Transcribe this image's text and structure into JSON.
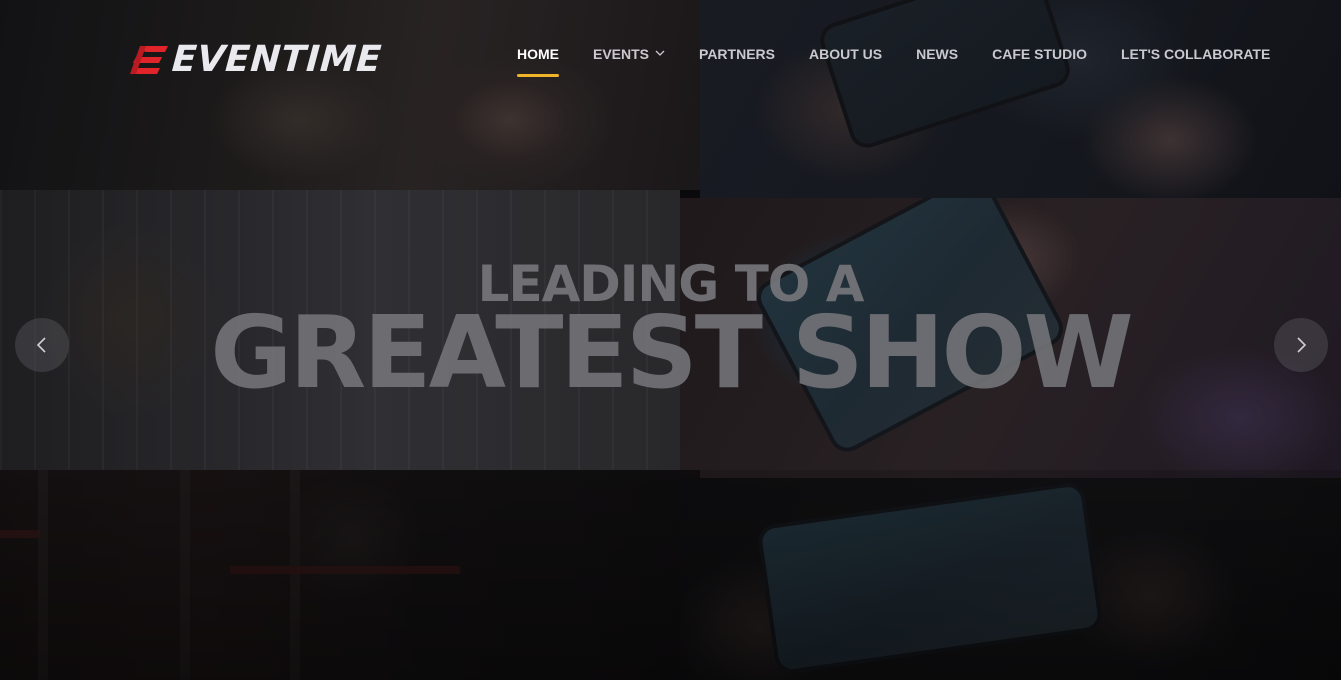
{
  "brand": {
    "name": "EVENTIME",
    "accent_color": "#e0242a"
  },
  "nav": {
    "items": [
      {
        "label": "HOME",
        "active": true
      },
      {
        "label": "EVENTS",
        "has_dropdown": true
      },
      {
        "label": "PARTNERS"
      },
      {
        "label": "ABOUT US"
      },
      {
        "label": "NEWS"
      },
      {
        "label": "CAFE STUDIO"
      },
      {
        "label": "LET'S COLLABORATE"
      }
    ],
    "active_underline_color": "#f0b429",
    "dropdown_icon": "chevron-down-icon"
  },
  "hero": {
    "headline_line1": "LEADING TO A",
    "headline_line2": "GREATEST SHOW",
    "prev_icon": "chevron-left-icon",
    "next_icon": "chevron-right-icon"
  }
}
